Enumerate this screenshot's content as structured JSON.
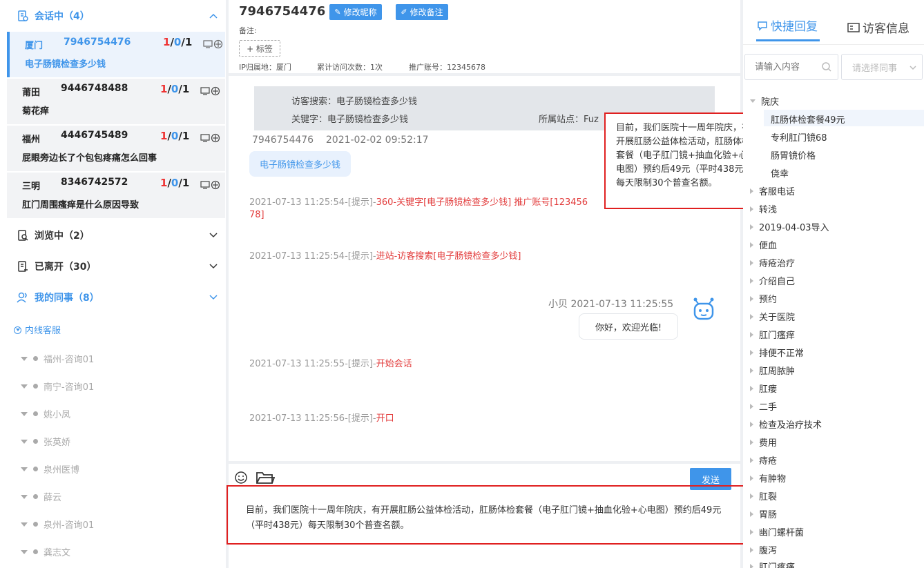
{
  "left": {
    "sections": {
      "active": {
        "label": "会话中（4）"
      },
      "browsing": {
        "label": "浏览中（2）"
      },
      "left": {
        "label": "已离开（30）"
      },
      "colleagues": {
        "label": "我的同事（8）"
      }
    },
    "sessions": [
      {
        "city": "厦门",
        "id": "7946754476",
        "count_a": "1",
        "count_b": "0",
        "count_c": "1",
        "last": "电子肠镜检查多少钱"
      },
      {
        "city": "莆田",
        "id": "9446748488",
        "count_a": "1",
        "count_b": "0",
        "count_c": "1",
        "last": "菊花痒"
      },
      {
        "city": "福州",
        "id": "4446745489",
        "count_a": "1",
        "count_b": "0",
        "count_c": "1",
        "last": "屁眼旁边长了个包包疼痛怎么回事"
      },
      {
        "city": "三明",
        "id": "8346742572",
        "count_a": "1",
        "count_b": "0",
        "count_c": "1",
        "last": "肛门周围瘙痒是什么原因导致"
      }
    ],
    "group": "内线客服",
    "colleagues": [
      "福州-咨询01",
      "南宁-咨询01",
      "姚小凤",
      "张英娇",
      "泉州医博",
      "薛云",
      "泉州-咨询01",
      "龚志文"
    ]
  },
  "header": {
    "visitor_id": "7946754476",
    "edit_nickname": "修改昵称",
    "edit_note": "修改备注",
    "note_label": "备注:",
    "tag_button": "+ 标签",
    "ip": "IP归属地：厦门",
    "visits": "累计访问次数：1次",
    "promo": "推广账号：12345678"
  },
  "chat": {
    "info_search": "访客搜索：电子肠镜检查多少钱",
    "info_keyword": "关键字：电子肠镜检查多少钱",
    "info_site": "所属站点：Fuz",
    "visitor_meta": "7946754476    2021-02-02 09:52:17",
    "visitor_msg": "电子肠镜检查多少钱",
    "tip1_gray": "2021-07-13 11:25:54-[提示]-",
    "tip1_red": "360-关键字[电子肠镜检查多少钱] 推广账号[123456",
    "tip1_red2": "78]",
    "tip2_gray": "2021-07-13 11:25:54-[提示]-",
    "tip2_red": "进站-访客搜索[电子肠镜检查多少钱]",
    "agent_meta": "小贝 2021-07-13 11:25:55",
    "agent_msg": "你好，欢迎光临!",
    "tip3_gray": "2021-07-13 11:25:55-[提示]-",
    "tip3_red": "开始会话",
    "tip4_gray": "2021-07-13 11:25:56-[提示]-",
    "tip4_red": "开口",
    "popup_text": "目前，我们医院十一周年院庆，有开展肛肠公益体检活动，肛肠体检套餐（电子肛门镜+抽血化验+心电图）预约后49元（平时438元）每天限制30个普查名额。"
  },
  "input": {
    "send": "发送",
    "text": "目前，我们医院十一周年院庆，有开展肛肠公益体检活动，肛肠体检套餐（电子肛门镜+抽血化验+心电图）预约后49元（平时438元）每天限制30个普查名额。"
  },
  "right": {
    "tab_quick": "快捷回复",
    "tab_visitor": "访客信息",
    "search_placeholder": "请输入内容",
    "select_placeholder": "请选择同事",
    "root": "院庆",
    "root_children": [
      "肛肠体检套餐49元",
      "专利肛门镜68",
      "肠胃镜价格",
      "侥幸"
    ],
    "tree": [
      "客服电话",
      "转浅",
      "2019-04-03导入",
      "便血",
      "痔疮治疗",
      "介绍自己",
      "预约",
      "关于医院",
      "肛门瘙痒",
      "排便不正常",
      "肛周脓肿",
      "肛瘘",
      "二手",
      "检查及治疗技术",
      "费用",
      "痔疮",
      "有肿物",
      "肛裂",
      "胃肠",
      "幽门螺杆菌",
      "腹泻",
      "肛门疼痛"
    ]
  },
  "colors": {
    "accent": "#3f95ea",
    "alert": "#e02020",
    "tip_red": "#e23a3a"
  }
}
